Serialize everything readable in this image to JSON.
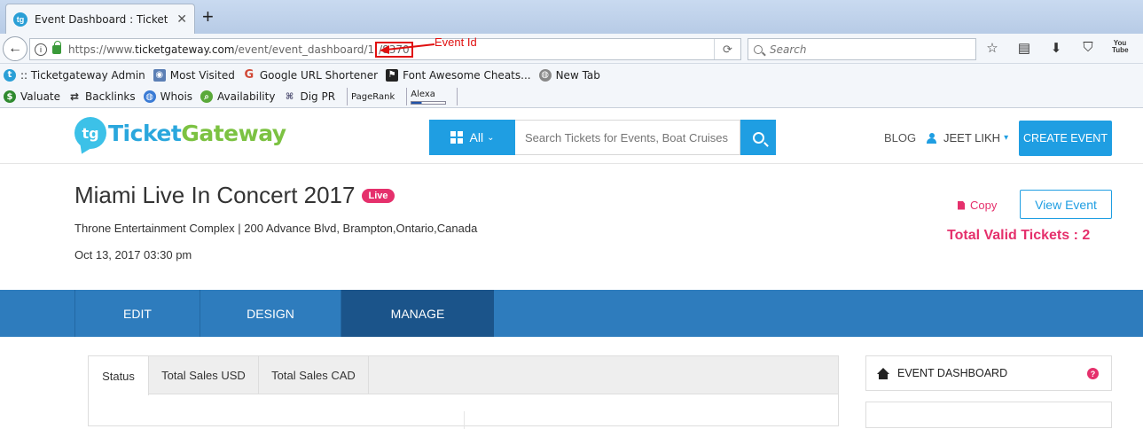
{
  "browser": {
    "tab_title": "Event Dashboard : Ticketgateway",
    "tab_favicon": "tg",
    "url_prefix": "https://www.",
    "url_domain": "ticketgateway.com",
    "url_path": "/event/event_dashboard/1",
    "url_event_id": "/8370",
    "search_placeholder": "Search",
    "youtube_label": "You Tube"
  },
  "annotation": {
    "label": "Event Id",
    "color": "#e01010"
  },
  "bookmarks_row1": [
    {
      "icon": "ticketgateway-icon",
      "label": ":: Ticketgateway Admin"
    },
    {
      "icon": "most-visited-icon",
      "label": "Most Visited"
    },
    {
      "icon": "google-icon",
      "label": "Google URL Shortener"
    },
    {
      "icon": "flag-icon",
      "label": "Font Awesome Cheats..."
    },
    {
      "icon": "globe-icon",
      "label": "New Tab"
    }
  ],
  "bookmarks_row2": [
    {
      "icon": "dollar-icon",
      "label": "Valuate"
    },
    {
      "icon": "arrows-icon",
      "label": "Backlinks"
    },
    {
      "icon": "globe-icon",
      "label": "Whois"
    },
    {
      "icon": "search-icon",
      "label": "Availability"
    },
    {
      "icon": "network-icon",
      "label": "Dig PR"
    },
    {
      "icon": "",
      "label": "PageRank"
    },
    {
      "icon": "",
      "label": "Alexa"
    }
  ],
  "site": {
    "logo_part1": "Ticket",
    "logo_part2": "Gateway",
    "category_label": "All",
    "search_placeholder": "Search Tickets for Events, Boat Cruises",
    "blog_label": "BLOG",
    "user_label": "JEET LIKH",
    "create_event_label": "CREATE EVENT",
    "brand_color": "#1f9ee2",
    "accent_color": "#e5306c"
  },
  "event": {
    "title": "Miami Live In Concert 2017",
    "status_badge": "Live",
    "venue": "Throne Entertainment Complex | 200 Advance Blvd, Brampton,Ontario,Canada",
    "date": "Oct 13, 2017 03:30 pm",
    "copy_label": "Copy",
    "view_label": "View Event",
    "total_tickets": "Total Valid Tickets : 2"
  },
  "nav_tabs": [
    {
      "label": "EDIT"
    },
    {
      "label": "DESIGN"
    },
    {
      "label": "MANAGE",
      "active": true
    }
  ],
  "content_tabs": [
    {
      "label": "Status",
      "active": true
    },
    {
      "label": "Total Sales USD"
    },
    {
      "label": "Total Sales CAD"
    }
  ],
  "sidebar": {
    "dashboard_label": "EVENT DASHBOARD"
  }
}
